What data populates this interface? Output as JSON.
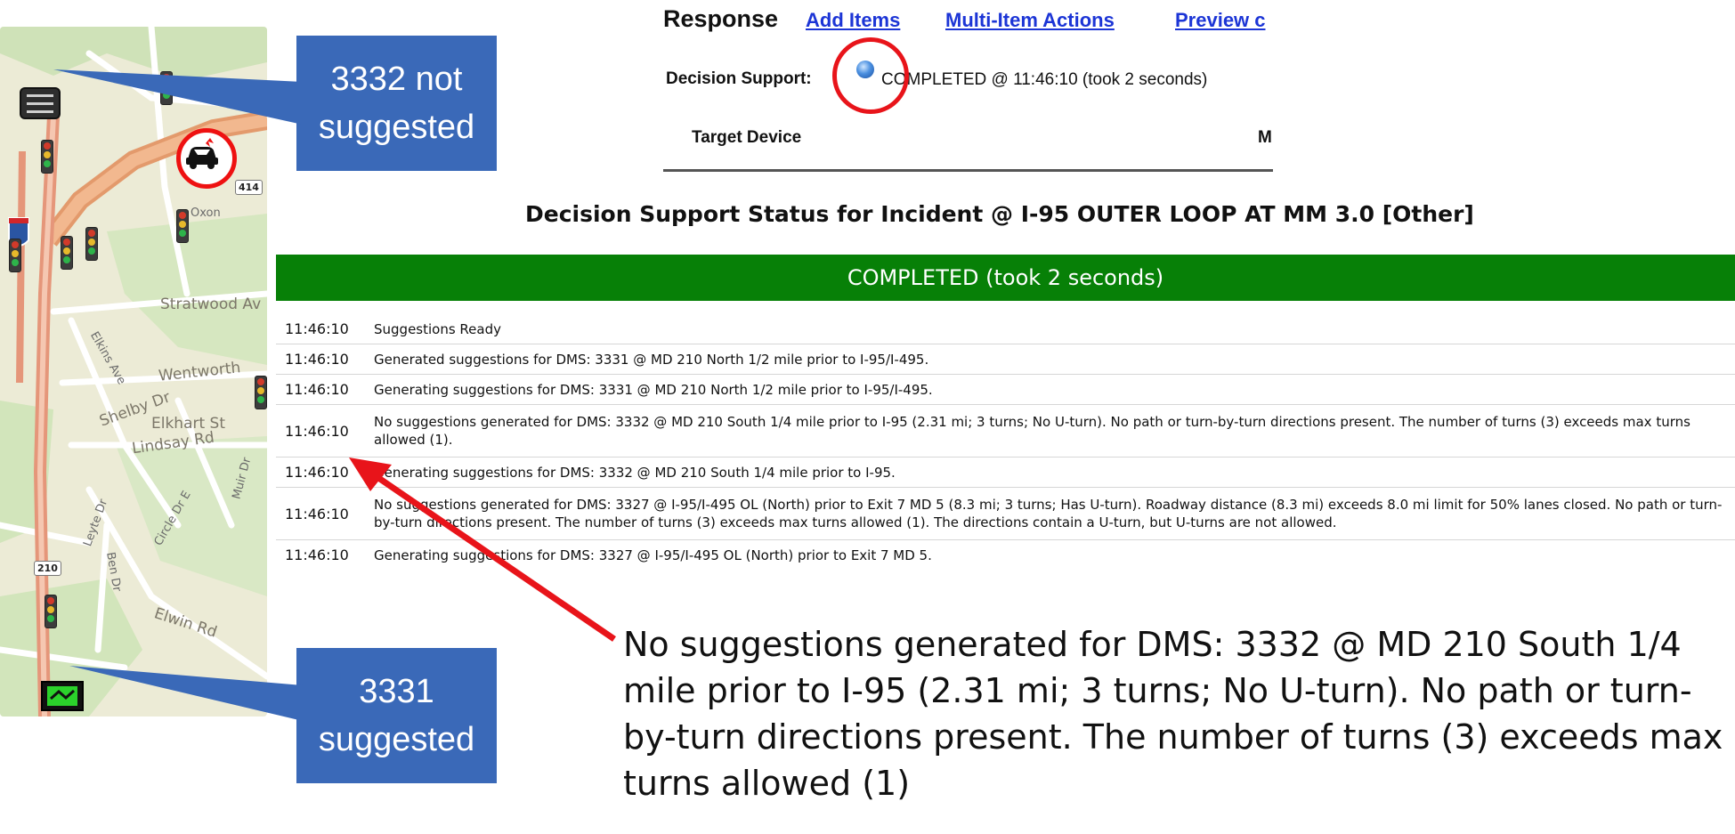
{
  "map": {
    "labels": {
      "stratwood": "Stratwood Av",
      "wentworth": "Wentworth",
      "elkhart": "Elkhart St",
      "lindsay": "Lindsay Rd",
      "elwin": "Elwin Rd",
      "shelby": "Shelby Dr",
      "oxon": "Oxon",
      "leyte": "Leyte Dr",
      "ben": "Ben Dr",
      "circle": "Circle Dr E",
      "muir": "Muir Dr",
      "elkins": "Elkins Ave"
    },
    "shields": {
      "route414": "414",
      "route210": "210"
    }
  },
  "callouts": {
    "top": {
      "line1": "3332 not",
      "line2": "suggested"
    },
    "bottom": {
      "line1": "3331",
      "line2": "suggested"
    }
  },
  "response": {
    "title": "Response",
    "links": [
      "Add Items",
      "Multi-Item Actions",
      "Preview c"
    ],
    "decision_support_label": "Decision Support:",
    "decision_support_status": "COMPLETED @ 11:46:10 (took 2 seconds)",
    "table_headers": [
      "Target Device",
      "Mi"
    ]
  },
  "status": {
    "title": "Decision Support Status for Incident @ I-95 OUTER LOOP AT MM 3.0 [Other]",
    "banner": "COMPLETED (took 2 seconds)",
    "log": [
      {
        "time": "11:46:10",
        "message": "Suggestions Ready"
      },
      {
        "time": "11:46:10",
        "message": "Generated suggestions for DMS: 3331 @ MD 210 North 1/2 mile prior to I-95/I-495."
      },
      {
        "time": "11:46:10",
        "message": "Generating suggestions for DMS: 3331 @ MD 210 North 1/2 mile prior to I-95/I-495."
      },
      {
        "time": "11:46:10",
        "message": "No suggestions generated for DMS: 3332 @ MD 210 South 1/4 mile prior to I-95 (2.31 mi; 3 turns; No U-turn). No path or turn-by-turn directions present. The number of turns (3) exceeds max turns allowed (1)."
      },
      {
        "time": "11:46:10",
        "message": "Generating suggestions for DMS: 3332 @ MD 210 South 1/4 mile prior to I-95."
      },
      {
        "time": "11:46:10",
        "message": "No suggestions generated for DMS: 3327 @ I-95/I-495 OL (North) prior to Exit 7 MD 5 (8.3 mi; 3 turns; Has U-turn). Roadway distance (8.3 mi) exceeds 8.0 mi limit for 50% lanes closed. No path or turn-by-turn directions present. The number of turns (3) exceeds max turns allowed (1). The directions contain a U-turn, but U-turns are not allowed."
      },
      {
        "time": "11:46:10",
        "message": "Generating suggestions for DMS: 3327 @ I-95/I-495 OL (North) prior to Exit 7 MD 5."
      }
    ]
  },
  "annotation": {
    "text": "No suggestions generated for DMS: 3332 @ MD 210 South 1/4 mile prior to I-95 (2.31 mi; 3 turns; No U-turn). No path or turn-by-turn directions present. The number of turns (3) exceeds max turns allowed (1)"
  },
  "colors": {
    "callout": "#3a69b8",
    "status_banner": "#078007",
    "link": "#1c35d6",
    "highlight": "#e8141a"
  }
}
